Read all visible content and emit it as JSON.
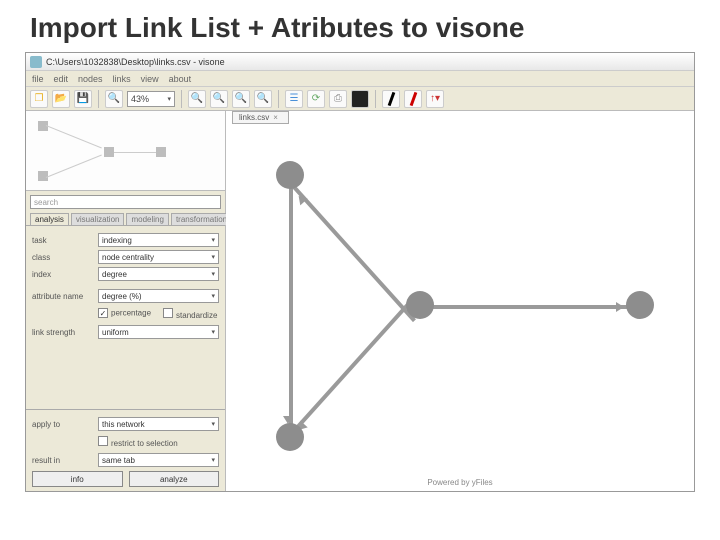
{
  "slide": {
    "title": "Import Link List + Atributes to visone"
  },
  "titlebar": {
    "text": "C:\\Users\\1032838\\Desktop\\links.csv - visone"
  },
  "menu": [
    "file",
    "edit",
    "nodes",
    "links",
    "view",
    "about"
  ],
  "toolbar": {
    "zoom": "43%"
  },
  "sidebar": {
    "search_placeholder": "search",
    "tabs": [
      "analysis",
      "visualization",
      "modeling",
      "transformation"
    ],
    "active_tab": 0,
    "fields": {
      "task_label": "task",
      "task_value": "indexing",
      "class_label": "class",
      "class_value": "node centrality",
      "index_label": "index",
      "index_value": "degree",
      "attr_label": "attribute name",
      "attr_value": "degree (%)",
      "percentage_label": "percentage",
      "percentage_checked": true,
      "standardize_label": "standardize",
      "standardize_checked": false,
      "linkstrength_label": "link strength",
      "linkstrength_value": "uniform"
    },
    "bottom": {
      "applyto_label": "apply to",
      "applyto_value": "this network",
      "restrict_label": "restrict to selection",
      "resultin_label": "result in",
      "resultin_value": "same tab",
      "info_btn": "info",
      "analyze_btn": "analyze"
    }
  },
  "canvas": {
    "tab_label": "links.csv",
    "footer": "Powered by yFiles"
  }
}
